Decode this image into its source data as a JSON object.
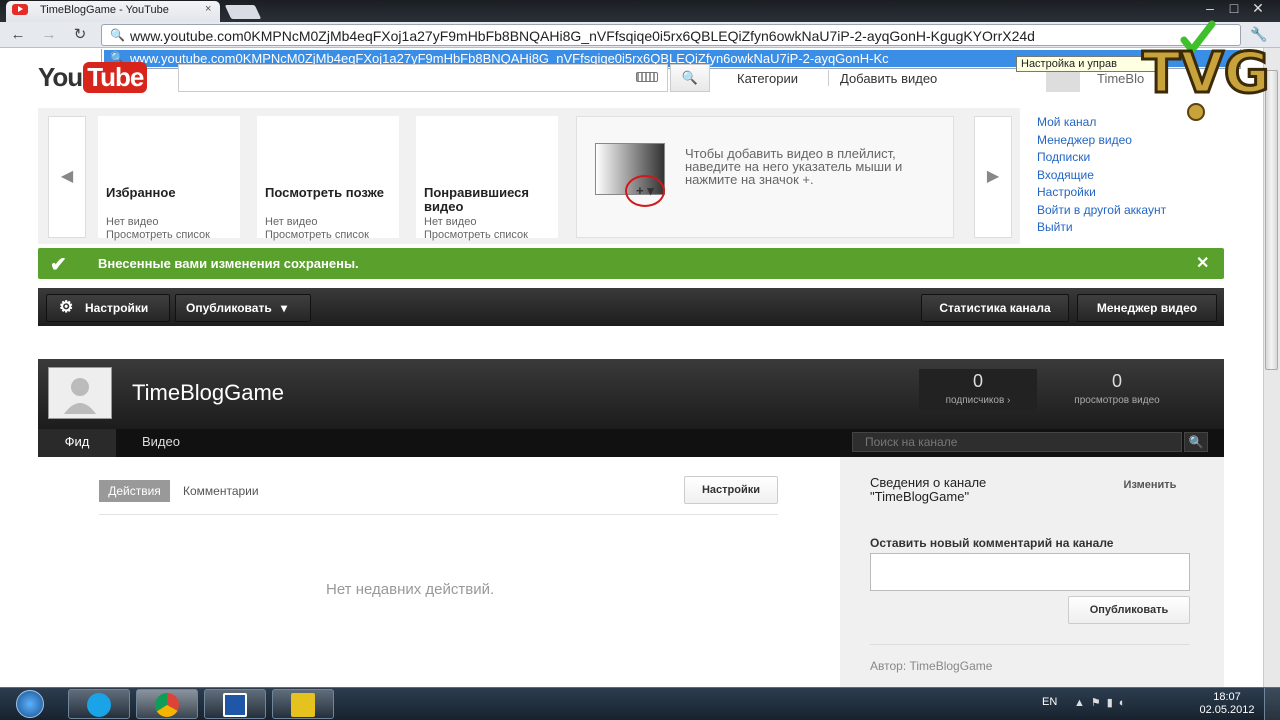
{
  "browser": {
    "tab_title": "TimeBlogGame - YouTube",
    "tab_close": "×",
    "window_controls": [
      "–",
      "□",
      "✕"
    ],
    "url": "www.youtube.com0KMPNcM0ZjMb4eqFXoj1a27yF9mHbFb8BNQAHi8G_nVFfsqiqe0i5rx6QBLEQiZfyn6owkNaU7iP-2-ayqGonH-KgugKYOrrX24d",
    "suggestion": "www.youtube.com0KMPNcM0ZjMb4eqFXoj1a27yF9mHbFb8BNQAHi8G_nVFfsqiqe0i5rx6QBLEQiZfyn6owkNaU7iP-2-ayqGonH-Kc",
    "tooltip": "Настройка и управ"
  },
  "youtube": {
    "logo_you": "You",
    "logo_tube": "Tube",
    "nav": {
      "categories": "Категории",
      "add_video": "Добавить видео"
    },
    "user_name": "TimeBlo"
  },
  "guide": {
    "cards": [
      {
        "title": "Избранное",
        "line1": "Нет видео",
        "line2": "Просмотреть список"
      },
      {
        "title": "Посмотреть позже",
        "line1": "Нет видео",
        "line2": "Просмотреть список"
      },
      {
        "title": "Понравившиеся видео",
        "line1": "Нет видео",
        "line2": "Просмотреть список"
      }
    ],
    "help_text": "Чтобы добавить видео в плейлист, наведите на него указатель мыши и нажмите на значок +.",
    "help_plus": "+ ▾",
    "side_links": [
      "Мой канал",
      "Менеджер видео",
      "Подписки",
      "Входящие",
      "Настройки",
      "Войти в другой аккаунт",
      "Выйти"
    ]
  },
  "success": {
    "text": "Внесенные вами изменения сохранены."
  },
  "channel_toolbar": {
    "settings": "Настройки",
    "publish": "Опубликовать",
    "stats": "Статистика канала",
    "video_manager": "Менеджер видео"
  },
  "channel": {
    "name": "TimeBlogGame",
    "subscribers": {
      "value": "0",
      "label": "подписчиков ›"
    },
    "views": {
      "value": "0",
      "label": "просмотров видео"
    },
    "tabs": {
      "feed": "Фид",
      "video": "Видео"
    },
    "search_placeholder": "Поиск на канале"
  },
  "feed": {
    "tab_actions": "Действия",
    "tab_comments": "Комментарии",
    "settings": "Настройки",
    "empty": "Нет недавних действий."
  },
  "sidebar": {
    "info_title": "Сведения о канале \"TimeBlogGame\"",
    "edit": "Изменить",
    "comment_label": "Оставить новый комментарий на канале",
    "post": "Опубликовать",
    "author": "Автор: TimeBlogGame"
  },
  "taskbar": {
    "lang": "EN",
    "time": "18:07",
    "date": "02.05.2012"
  },
  "watermark": {
    "text": "TVG"
  },
  "colors": {
    "success": "#5aa02c",
    "link": "#2366c4",
    "yt_red": "#d8251c"
  }
}
